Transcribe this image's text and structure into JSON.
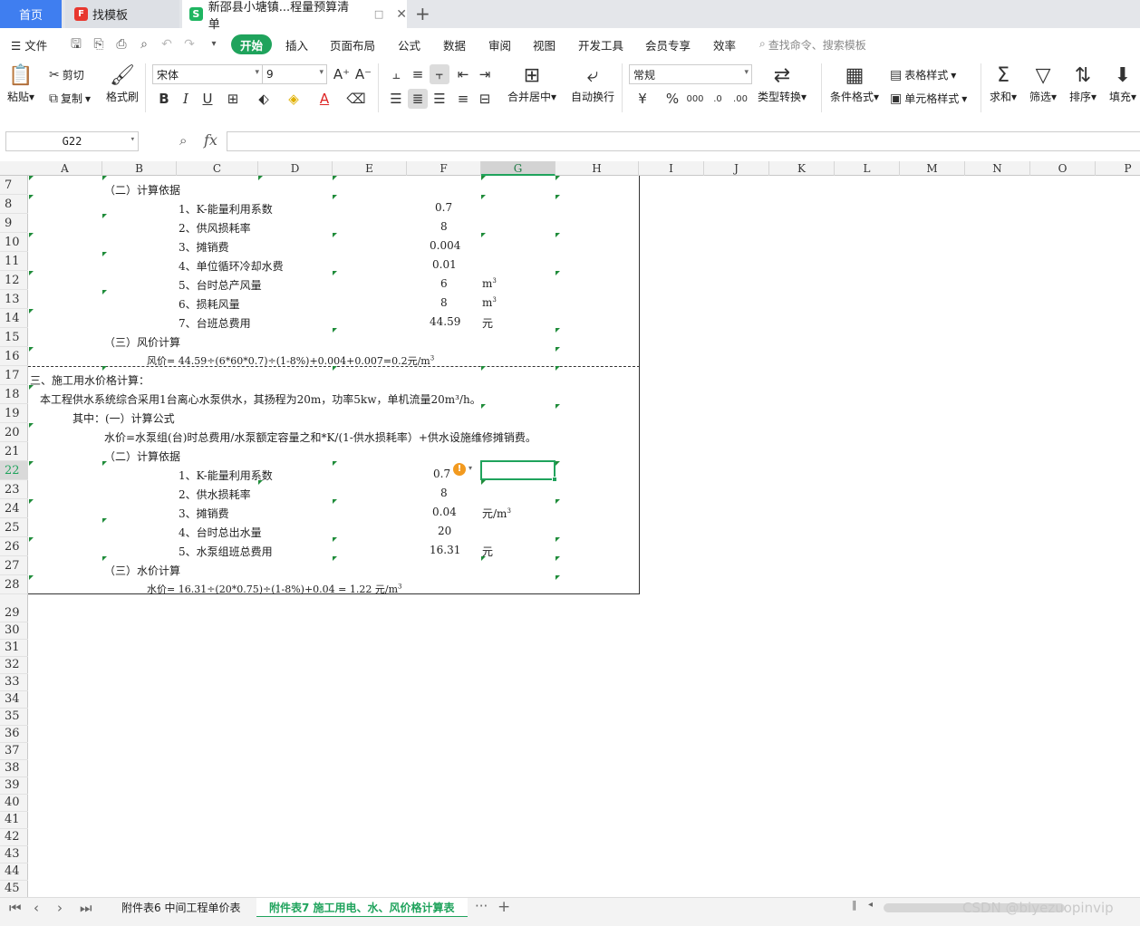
{
  "tabs": {
    "home": "首页",
    "template": "找模板",
    "template_logo": "F",
    "document": "新邵县小塘镇...程量预算清单",
    "document_logo": "S",
    "pin": "□",
    "close": "✕",
    "new": "+"
  },
  "menu": {
    "file": "文件",
    "items": [
      "开始",
      "插入",
      "页面布局",
      "公式",
      "数据",
      "审阅",
      "视图",
      "开发工具",
      "会员专享",
      "效率"
    ],
    "search": "查找命令、搜索模板"
  },
  "ribbon": {
    "paste": "粘贴",
    "cut": "剪切",
    "copy": "复制",
    "format_painter": "格式刷",
    "font_name": "宋体",
    "font_size": "9",
    "merge_center": "合并居中",
    "auto_wrap": "自动换行",
    "number_format": "常规",
    "type_convert": "类型转换",
    "cond_format": "条件格式",
    "table_style": "表格样式",
    "cell_style": "单元格样式",
    "sum": "求和",
    "filter": "筛选",
    "sort": "排序",
    "fill": "填充"
  },
  "formula_bar": {
    "cell_ref": "G22",
    "fx": "fx",
    "content": ""
  },
  "grid": {
    "columns": [
      "A",
      "B",
      "C",
      "D",
      "E",
      "F",
      "G",
      "H",
      "I",
      "J",
      "K",
      "L",
      "M",
      "N",
      "O",
      "P"
    ],
    "selected_column": "G",
    "rows": [
      "7",
      "8",
      "9",
      "10",
      "11",
      "12",
      "13",
      "14",
      "15",
      "16",
      "17",
      "18",
      "19",
      "20",
      "21",
      "22",
      "23",
      "24",
      "25",
      "26",
      "27",
      "28",
      "29",
      "30",
      "31",
      "32",
      "33",
      "34",
      "35",
      "36",
      "37",
      "38",
      "39",
      "40",
      "41",
      "42",
      "43",
      "44",
      "45"
    ],
    "selected_row": "22",
    "cells": {
      "r7": "（二）计算依据",
      "r8_label": "1、K-能量利用系数",
      "r8_val": "0.7",
      "r9_label": "2、供风损耗率",
      "r9_val": "8",
      "r10_label": "3、摊销费",
      "r10_val": "0.004",
      "r11_label": "4、单位循环冷却水费",
      "r11_val": "0.01",
      "r12_label": "5、台时总产风量",
      "r12_val": "6",
      "r12_unit": "m",
      "r13_label": "6、损耗风量",
      "r13_val": "8",
      "r13_unit": "m",
      "r14_label": "7、台班总费用",
      "r14_val": "44.59",
      "r14_unit": "元",
      "r15": "（三）风价计算",
      "r16": "风价= 44.59÷(6*60*0.7)÷(1-8%)+0.004+0.007=0.2元/m",
      "r17": "三、施工用水价格计算：",
      "r18": "本工程供水系统综合采用1台离心水泵供水，其扬程为20m，功率5kw，单机流量20m³/h。",
      "r19": "其中：(一）计算公式",
      "r20": "水价=水泵组(台)时总费用/水泵额定容量之和*K/(1-供水损耗率）+供水设施维修摊销费。",
      "r21": "（二）计算依据",
      "r22_label": "1、K-能量利用系数",
      "r22_val": "0.7",
      "r23_label": "2、供水损耗率",
      "r23_val": "8",
      "r24_label": "3、摊销费",
      "r24_val": "0.04",
      "r24_unit": "元/m",
      "r25_label": "4、台时总出水量",
      "r25_val": "20",
      "r26_label": "5、水泵组班总费用",
      "r26_val": "16.31",
      "r26_unit": "元",
      "r27": "（三）水价计算",
      "r28": "水价= 16.31÷(20*0.75)÷(1-8%)+0.04 = 1.22 元/m",
      "sup3": "3",
      "warn": "!"
    }
  },
  "sheets": {
    "tab1": "附件表6 中间工程单价表",
    "tab2": "附件表7 施工用电、水、风价格计算表",
    "more": "···",
    "add": "+"
  },
  "watermark": "CSDN @biyezuopinvip"
}
